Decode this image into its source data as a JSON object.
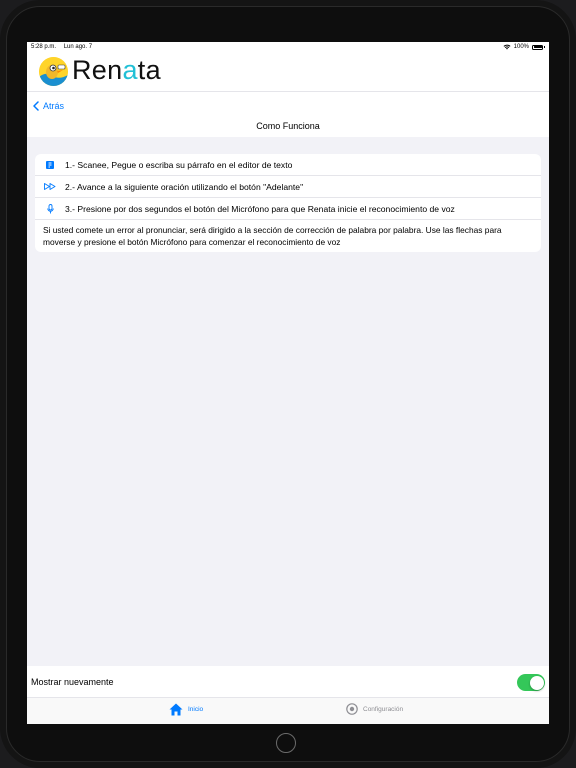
{
  "status_bar": {
    "time": "5:28 p.m.",
    "date": "Lun ago. 7",
    "battery": "100%"
  },
  "header": {
    "logo_text_a": "Ren",
    "logo_text_b": "a",
    "logo_text_c": "ta"
  },
  "nav": {
    "back_label": "Atrás",
    "title": "Como Funciona"
  },
  "steps": [
    {
      "icon": "document-icon",
      "text": "1.- Scanee, Pegue o escriba su párrafo en el editor de texto"
    },
    {
      "icon": "fast-forward-icon",
      "text": "2.- Avance a la siguiente oración utilizando el botón \"Adelante\""
    },
    {
      "icon": "microphone-icon",
      "text": "3.- Presione por dos segundos el botón del Micrófono para que Renata inicie el reconocimiento de voz"
    }
  ],
  "note": "Si usted comete un error al pronunciar, será dirigido a la sección de corrección de palabra por palabra. Use las flechas para moverse y presione el botón Micrófono para comenzar el reconocimiento de voz",
  "settings": {
    "show_again_label": "Mostrar nuevamente",
    "show_again_on": true
  },
  "tabs": {
    "inicio": "Inicio",
    "configuracion": "Configuración"
  },
  "colors": {
    "accent": "#007aff",
    "toggle_on": "#34c759",
    "logo_accent": "#21c0d6",
    "background": "#f2f2f7"
  }
}
